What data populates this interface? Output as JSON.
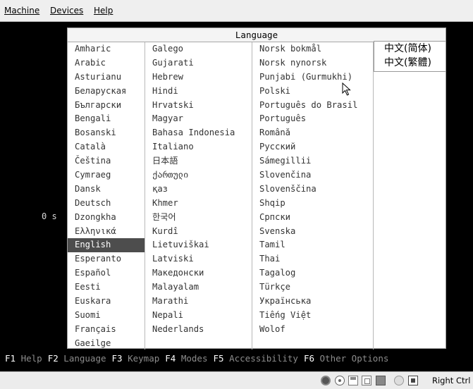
{
  "menubar": {
    "machine": "Machine",
    "devices": "Devices",
    "help": "Help"
  },
  "dialog": {
    "title": "Language"
  },
  "languages": {
    "col1": [
      "Amharic",
      "Arabic",
      "Asturianu",
      "Беларуская",
      "Български",
      "Bengali",
      "Bosanski",
      "Català",
      "Čeština",
      "Cymraeg",
      "Dansk",
      "Deutsch",
      "Dzongkha",
      "Ελληνικά",
      "English",
      "Esperanto",
      "Español",
      "Eesti",
      "Euskara",
      "Suomi",
      "Français",
      "Gaeilge"
    ],
    "col2": [
      "Galego",
      "Gujarati",
      "Hebrew",
      "Hindi",
      "Hrvatski",
      "Magyar",
      "Bahasa Indonesia",
      "Italiano",
      "日本語",
      "ქართული",
      "қаз",
      "Khmer",
      "한국어",
      "Kurdî",
      "Lietuviškai",
      "Latviski",
      "Македонски",
      "Malayalam",
      "Marathi",
      "Nepali",
      "Nederlands"
    ],
    "col3": [
      "Norsk bokmål",
      "Norsk nynorsk",
      "Punjabi (Gurmukhi)",
      "Polski",
      "Português do Brasil",
      "Português",
      "Română",
      "Русский",
      "Sámegillii",
      "Slovenčina",
      "Slovenščina",
      "Shqip",
      "Српски",
      "Svenska",
      "Tamil",
      "Thai",
      "Tagalog",
      "Türkçe",
      "Українська",
      "Tiếng Việt",
      "Wolof"
    ],
    "col4": [
      "中文(简体)",
      "中文(繁體)"
    ],
    "selected": "English"
  },
  "timer": "0 s",
  "fkeys": [
    {
      "key": "F1",
      "label": "Help"
    },
    {
      "key": "F2",
      "label": "Language"
    },
    {
      "key": "F3",
      "label": "Keymap"
    },
    {
      "key": "F4",
      "label": "Modes"
    },
    {
      "key": "F5",
      "label": "Accessibility"
    },
    {
      "key": "F6",
      "label": "Other Options"
    }
  ],
  "statusbar": {
    "host_key": "Right Ctrl",
    "icons": [
      "hard-disk-icon",
      "cd-icon",
      "floppy-icon",
      "network-icon",
      "shared-folder-icon",
      "usb-icon",
      "mouse-integration-icon"
    ]
  },
  "colors": {
    "selected_bg": "#4d4d4d",
    "screen_bg": "#000000",
    "fkey_dim": "#8c8c8c"
  }
}
